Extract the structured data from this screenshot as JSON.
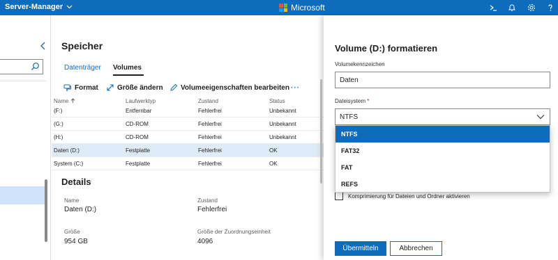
{
  "topbar": {
    "app_title": "Server-Manager",
    "brand": "Microsoft",
    "brand_colors": [
      "#f25022",
      "#7fba00",
      "#00a4ef",
      "#ffb900"
    ],
    "icons": [
      "terminal-icon",
      "bell-icon",
      "gear-icon",
      "help-icon"
    ],
    "accent": "#0f6cbd"
  },
  "storage": {
    "title": "Speicher",
    "tabs": [
      {
        "label": "Datenträger",
        "active": false
      },
      {
        "label": "Volumes",
        "active": true
      }
    ],
    "commands": {
      "format": "Format",
      "resize": "Größe ändern",
      "properties": "Volumeeigenschaften bearbeiten",
      "more": "···"
    },
    "columns": [
      "Name",
      "Laufwerktyp",
      "Zustand",
      "Status"
    ],
    "rows": [
      {
        "name": "(F:)",
        "type": "Entfernbar",
        "health": "Fehlerfrei",
        "status": "Unbekannt"
      },
      {
        "name": "(G:)",
        "type": "CD-ROM",
        "health": "Fehlerfrei",
        "status": "Unbekannt"
      },
      {
        "name": "(H:)",
        "type": "CD-ROM",
        "health": "Fehlerfrei",
        "status": "Unbekannt"
      },
      {
        "name": "Daten (D:)",
        "type": "Festplatte",
        "health": "Fehlerfrei",
        "status": "OK"
      },
      {
        "name": "System (C:)",
        "type": "Festplatte",
        "health": "Fehlerfrei",
        "status": "OK"
      }
    ],
    "selected_row": 3
  },
  "details": {
    "title": "Details",
    "name_label": "Name",
    "name_value": "Daten (D:)",
    "health_label": "Zustand",
    "health_value": "Fehlerfrei",
    "size_label": "Größe",
    "size_value": "954 GB",
    "alloc_label": "Größe der Zuordnungseinheit",
    "alloc_value": "4096"
  },
  "panel": {
    "title": "Volume (D:) formatieren",
    "label_field_label": "Volumekennzeichen",
    "label_field_value": "Daten",
    "fs_label": "Dateisystem",
    "fs_required": "*",
    "fs_value": "NTFS",
    "fs_options": [
      "NTFS",
      "FAT32",
      "FAT",
      "REFS"
    ],
    "compression_label": "Komprimierung für Dateien und Ordner aktivieren",
    "submit": "Übermitteln",
    "cancel": "Abbrechen"
  }
}
